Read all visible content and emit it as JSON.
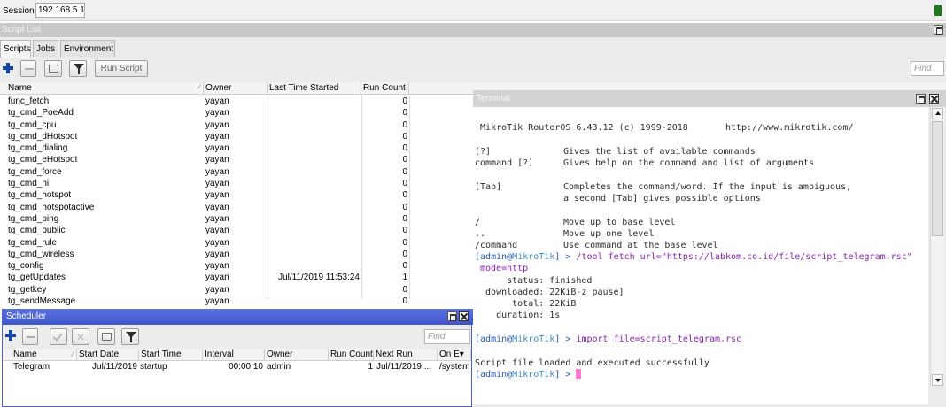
{
  "session": {
    "label": "Session:",
    "value": "192.168.5.1",
    "indicator_color": "#1d7a1d"
  },
  "script_list": {
    "title": "Script List",
    "tabs": [
      "Scripts",
      "Jobs",
      "Environment"
    ],
    "active_tab": "Scripts",
    "toolbar": {
      "add_icon": "plus-icon",
      "remove_icon": "minus-icon",
      "comment_icon": "comment-icon",
      "filter_icon": "filter-icon",
      "run_script_label": "Run Script",
      "find_placeholder": "Find"
    },
    "columns": [
      "Name",
      "Owner",
      "Last Time Started",
      "Run Count"
    ],
    "rows": [
      {
        "name": "func_fetch",
        "owner": "yayan",
        "last_started": "",
        "run_count": "0"
      },
      {
        "name": "tg_cmd_PoeAdd",
        "owner": "yayan",
        "last_started": "",
        "run_count": "0"
      },
      {
        "name": "tg_cmd_cpu",
        "owner": "yayan",
        "last_started": "",
        "run_count": "0"
      },
      {
        "name": "tg_cmd_dHotspot",
        "owner": "yayan",
        "last_started": "",
        "run_count": "0"
      },
      {
        "name": "tg_cmd_dialing",
        "owner": "yayan",
        "last_started": "",
        "run_count": "0"
      },
      {
        "name": "tg_cmd_eHotspot",
        "owner": "yayan",
        "last_started": "",
        "run_count": "0"
      },
      {
        "name": "tg_cmd_force",
        "owner": "yayan",
        "last_started": "",
        "run_count": "0"
      },
      {
        "name": "tg_cmd_hi",
        "owner": "yayan",
        "last_started": "",
        "run_count": "0"
      },
      {
        "name": "tg_cmd_hotspot",
        "owner": "yayan",
        "last_started": "",
        "run_count": "0"
      },
      {
        "name": "tg_cmd_hotspotactive",
        "owner": "yayan",
        "last_started": "",
        "run_count": "0"
      },
      {
        "name": "tg_cmd_ping",
        "owner": "yayan",
        "last_started": "",
        "run_count": "0"
      },
      {
        "name": "tg_cmd_public",
        "owner": "yayan",
        "last_started": "",
        "run_count": "0"
      },
      {
        "name": "tg_cmd_rule",
        "owner": "yayan",
        "last_started": "",
        "run_count": "0"
      },
      {
        "name": "tg_cmd_wireless",
        "owner": "yayan",
        "last_started": "",
        "run_count": "0"
      },
      {
        "name": "tg_config",
        "owner": "yayan",
        "last_started": "",
        "run_count": "0"
      },
      {
        "name": "tg_getUpdates",
        "owner": "yayan",
        "last_started": "Jul/11/2019 11:53:24",
        "run_count": "1"
      },
      {
        "name": "tg_getkey",
        "owner": "yayan",
        "last_started": "",
        "run_count": "0"
      },
      {
        "name": "tg_sendMessage",
        "owner": "yayan",
        "last_started": "",
        "run_count": "0"
      }
    ]
  },
  "scheduler": {
    "title": "Scheduler",
    "find_placeholder": "Find",
    "columns": [
      "Name",
      "Start Date",
      "Start Time",
      "Interval",
      "Owner",
      "Run Count",
      "Next Run",
      "On E▾"
    ],
    "rows": [
      {
        "name": "Telegram",
        "start_date": "Jul/11/2019",
        "start_time": "startup",
        "interval": "00:00:10",
        "owner": "admin",
        "run_count": "1",
        "next_run": "Jul/11/2019 ...",
        "on_event": "/system"
      }
    ]
  },
  "terminal": {
    "title": "Terminal",
    "banner": "MikroTik RouterOS 6.43.12 (c) 1999-2018       http://www.mikrotik.com/",
    "help": [
      {
        "key": "[?]",
        "desc": "Gives the list of available commands"
      },
      {
        "key": "command [?]",
        "desc": "Gives help on the command and list of arguments"
      },
      {
        "key": "[Tab]",
        "desc": "Completes the command/word. If the input is ambiguous,"
      },
      {
        "key": "",
        "desc": "a second [Tab] gives possible options"
      },
      {
        "key": "/",
        "desc": "Move up to base level"
      },
      {
        "key": "..",
        "desc": "Move up one level"
      },
      {
        "key": "/command",
        "desc": "Use command at the base level"
      }
    ],
    "prompt_user": "admin",
    "prompt_host": "MikroTik",
    "cmd1": "/tool fetch url=\"https://labkom.co.id/file/script_telegram.rsc\"",
    "cmd1_cont": " mode=http",
    "fetch_output": [
      "      status: finished",
      "  downloaded: 22KiB-z pause]",
      "       total: 22KiB",
      "    duration: 1s"
    ],
    "cmd2": "import file=script_telegram.rsc",
    "result": "Script file loaded and executed successfully"
  }
}
